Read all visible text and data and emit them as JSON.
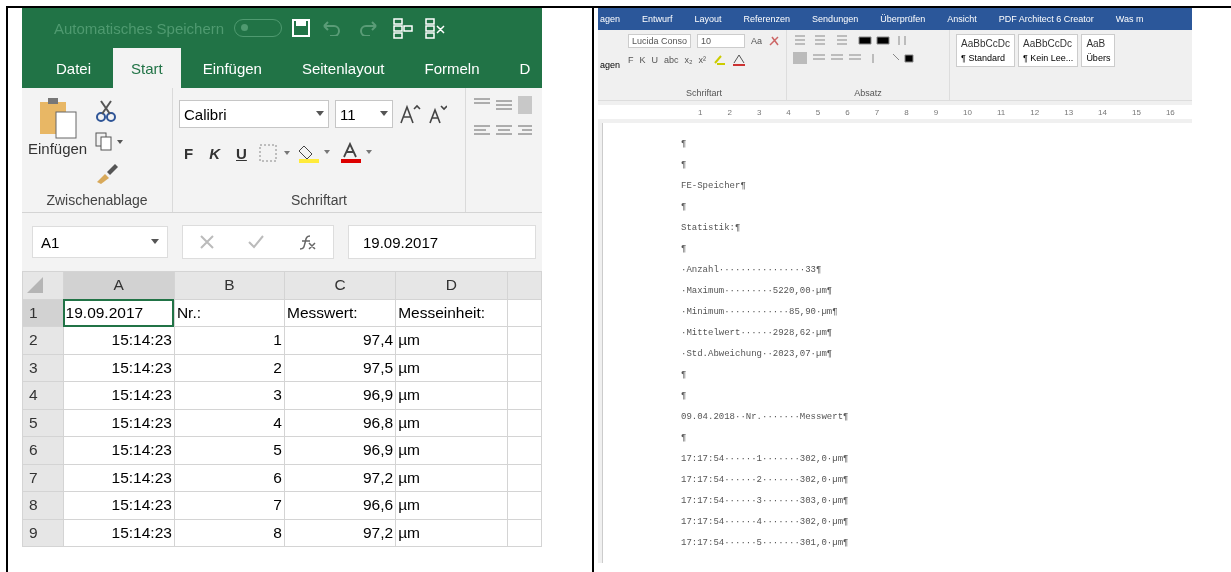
{
  "excel": {
    "title_bar": {
      "autosave_label": "Automatisches Speichern",
      "autosave_on": false
    },
    "tabs": [
      {
        "label": "Datei",
        "selected": false
      },
      {
        "label": "Start",
        "selected": true
      },
      {
        "label": "Einfügen",
        "selected": false
      },
      {
        "label": "Seitenlayout",
        "selected": false
      },
      {
        "label": "Formeln",
        "selected": false
      },
      {
        "label": "D",
        "selected": false
      }
    ],
    "ribbon": {
      "paste_label": "Einfügen",
      "font_name": "Calibri",
      "font_size": "11",
      "format_buttons": [
        "F",
        "K",
        "U"
      ],
      "groups": [
        "Zwischenablage",
        "Schriftart"
      ]
    },
    "formula_bar": {
      "name_box": "A1",
      "formula": "19.09.2017"
    },
    "sheet": {
      "columns": [
        {
          "label": "A",
          "selected": true
        },
        {
          "label": "B",
          "selected": false
        },
        {
          "label": "C",
          "selected": false
        },
        {
          "label": "D",
          "selected": false
        }
      ],
      "rows": [
        {
          "label": "1",
          "kind": "header",
          "selected": true,
          "cells": [
            "19.09.2017",
            "Nr.:",
            "Messwert:",
            "Messeinheit:"
          ]
        },
        {
          "label": "2",
          "kind": "data",
          "selected": false,
          "cells": [
            "15:14:23",
            "1",
            "97,4",
            "µm"
          ]
        },
        {
          "label": "3",
          "kind": "data",
          "selected": false,
          "cells": [
            "15:14:23",
            "2",
            "97,5",
            "µm"
          ]
        },
        {
          "label": "4",
          "kind": "data",
          "selected": false,
          "cells": [
            "15:14:23",
            "3",
            "96,9",
            "µm"
          ]
        },
        {
          "label": "5",
          "kind": "data",
          "selected": false,
          "cells": [
            "15:14:23",
            "4",
            "96,8",
            "µm"
          ]
        },
        {
          "label": "6",
          "kind": "data",
          "selected": false,
          "cells": [
            "15:14:23",
            "5",
            "96,9",
            "µm"
          ]
        },
        {
          "label": "7",
          "kind": "data",
          "selected": false,
          "cells": [
            "15:14:23",
            "6",
            "97,2",
            "µm"
          ]
        },
        {
          "label": "8",
          "kind": "data",
          "selected": false,
          "cells": [
            "15:14:23",
            "7",
            "96,6",
            "µm"
          ]
        },
        {
          "label": "9",
          "kind": "data",
          "selected": false,
          "cells": [
            "15:14:23",
            "8",
            "97,2",
            "µm"
          ]
        }
      ]
    }
  },
  "word": {
    "tabs": [
      "agen",
      "Entwurf",
      "Layout",
      "Referenzen",
      "Sendungen",
      "Überprüfen",
      "Ansicht",
      "PDF Architect 6 Creator",
      "Was m"
    ],
    "ribbon": {
      "paste_label": "agen",
      "font_name": "Lucida Conso",
      "font_size": "10",
      "change_case": "Aa",
      "format_buttons": [
        "F",
        "K",
        "U",
        "abc",
        "x₂",
        "x²"
      ],
      "styles": [
        {
          "sample": "AaBbCcDc",
          "name": "¶ Standard"
        },
        {
          "sample": "AaBbCcDc",
          "name": "¶ Kein Lee..."
        },
        {
          "sample": "AaB",
          "name": "Übers"
        }
      ],
      "groups": [
        "Schriftart",
        "Absatz"
      ]
    },
    "ruler": [
      "1",
      "2",
      "3",
      "4",
      "5",
      "6",
      "7",
      "8",
      "9",
      "10",
      "11",
      "12",
      "13",
      "14",
      "15",
      "16"
    ],
    "document_lines": [
      "¶",
      "¶",
      "FE-Speicher¶",
      "¶",
      "Statistik:¶",
      "¶",
      "·Anzahl················33¶",
      "·Maximum·········5220,00·µm¶",
      "·Minimum············85,90·µm¶",
      "·Mittelwert······2928,62·µm¶",
      "·Std.Abweichung··2023,07·µm¶",
      "¶",
      "¶",
      "09.04.2018··Nr.·······Messwert¶",
      "¶",
      "17:17:54······1·······302,0·µm¶",
      "17:17:54······2·······302,0·µm¶",
      "17:17:54······3·······303,0·µm¶",
      "17:17:54······4·······302,0·µm¶",
      "17:17:54······5·······301,0·µm¶"
    ]
  }
}
